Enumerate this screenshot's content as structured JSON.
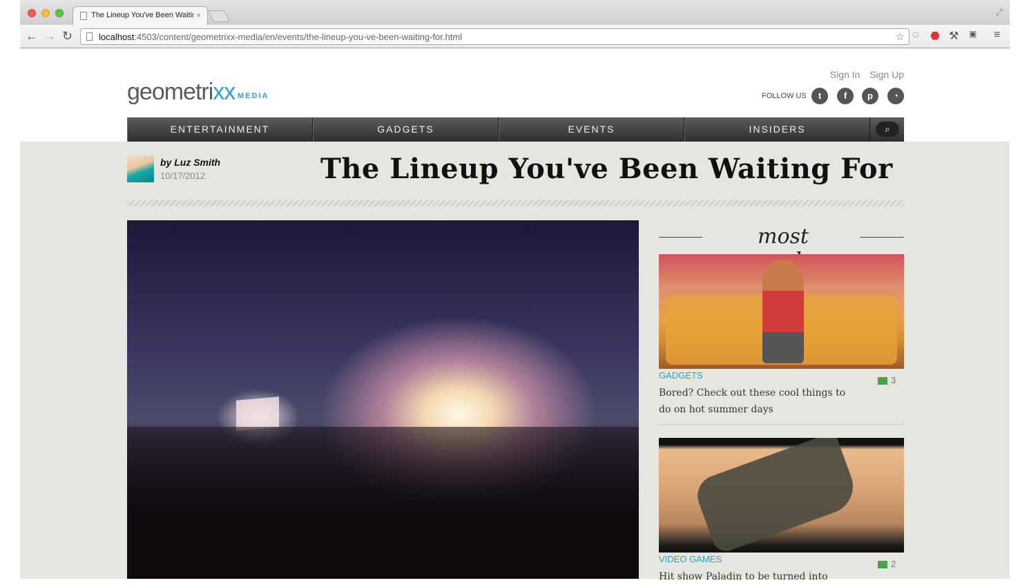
{
  "browser": {
    "tab_title": "The Lineup You've Been Waiting For",
    "tab_close": "×",
    "url_host": "localhost",
    "url_rest": ":4503/content/geometrixx-media/en/events/the-lineup-you-ve-been-waiting-for.html"
  },
  "header": {
    "logo_main": "geometri",
    "logo_xx": "xx",
    "logo_sub": "MEDIA",
    "sign_in": "Sign In",
    "sign_up": "Sign Up",
    "follow_us": "FOLLOW US"
  },
  "nav": {
    "items": [
      "ENTERTAINMENT",
      "GADGETS",
      "EVENTS",
      "INSIDERS"
    ]
  },
  "article": {
    "byline": "by Luz Smith",
    "date": "10/17/2012",
    "title": "The Lineup You've Been Waiting For"
  },
  "sidebar": {
    "heading": "most popular",
    "cards": [
      {
        "category": "GADGETS",
        "comments": "3",
        "title": "Bored? Check out these cool things to do on hot summer days"
      },
      {
        "category": "VIDEO GAMES",
        "comments": "2",
        "title": "Hit show Paladin to be turned into"
      }
    ]
  },
  "colors": {
    "accent": "#27a3c2",
    "comment_green": "#4aa34a",
    "content_bg": "#e6e6e1"
  }
}
